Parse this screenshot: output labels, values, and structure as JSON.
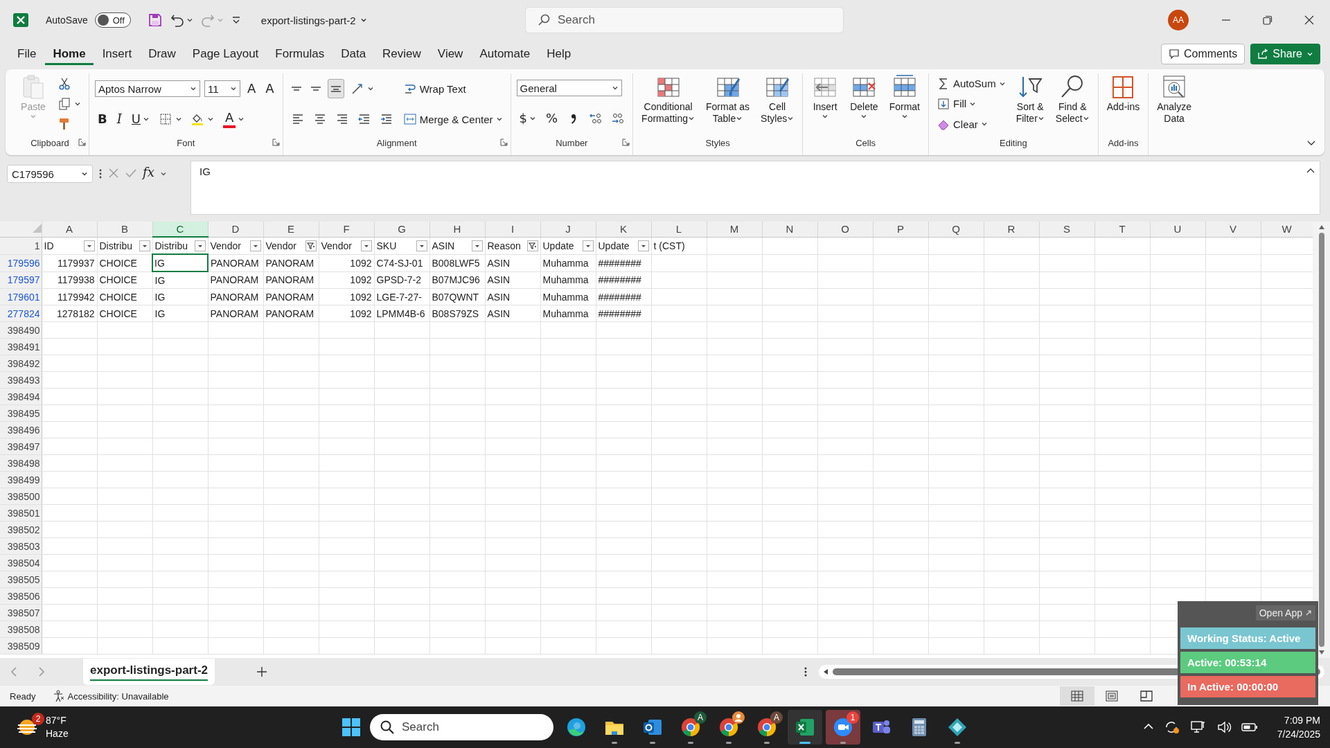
{
  "title_bar": {
    "autosave_label": "AutoSave",
    "autosave": {
      "on": false,
      "label": "Off"
    },
    "undo": {
      "disabled": false
    },
    "redo": {
      "disabled": true
    },
    "file_name": "export-listings-part-2",
    "search": {
      "placeholder": "Search"
    },
    "avatar": "AA"
  },
  "menu_tabs": [
    {
      "label": "File",
      "selected": false
    },
    {
      "label": "Home",
      "selected": true
    },
    {
      "label": "Insert",
      "selected": false
    },
    {
      "label": "Draw",
      "selected": false
    },
    {
      "label": "Page Layout",
      "selected": false
    },
    {
      "label": "Formulas",
      "selected": false
    },
    {
      "label": "Data",
      "selected": false
    },
    {
      "label": "Review",
      "selected": false
    },
    {
      "label": "View",
      "selected": false
    },
    {
      "label": "Automate",
      "selected": false
    },
    {
      "label": "Help",
      "selected": false
    }
  ],
  "header_buttons": [
    {
      "label": "Comments",
      "kind": "outline"
    },
    {
      "label": "Share",
      "kind": "primary"
    }
  ],
  "ribbon": {
    "groups": [
      {
        "label": "Clipboard",
        "launcher": true,
        "sections": [
          {
            "kind": "large",
            "lines": [
              "Paste"
            ],
            "caret": true,
            "disabled": true
          },
          {
            "kind": "stack",
            "tiers": [
              [
                {
                  "kind": "small"
                }
              ],
              [
                {
                  "kind": "small",
                  "caret": true
                }
              ],
              [
                {
                  "kind": "small"
                }
              ]
            ]
          }
        ]
      },
      {
        "label": "Font",
        "launcher": true,
        "sections": [
          {
            "kind": "stack",
            "tiers": [
              [
                {
                  "kind": "combo",
                  "text": "Aptos Narrow",
                  "wide": true
                },
                {
                  "kind": "combo",
                  "text": "11"
                },
                {
                  "kind": "glyph",
                  "text": "A"
                },
                {
                  "kind": "glyph",
                  "text": "A"
                }
              ],
              [
                {
                  "kind": "bold",
                  "text": "B"
                },
                {
                  "kind": "italic",
                  "text": "I"
                },
                {
                  "kind": "underline",
                  "text": "U",
                  "caret": true
                },
                {
                  "kind": "small",
                  "caret": true
                },
                {
                  "kind": "small",
                  "caret": true
                },
                {
                  "kind": "glyph",
                  "text": "A",
                  "color": "#e81123",
                  "caret": true
                }
              ]
            ]
          }
        ]
      },
      {
        "label": "Alignment",
        "launcher": true,
        "sections": [
          {
            "kind": "stack",
            "tiers": [
              [
                {
                  "kind": "small",
                  "pressed": false
                },
                {
                  "kind": "small",
                  "pressed": false
                },
                {
                  "kind": "small",
                  "pressed": true
                },
                {
                  "kind": "small",
                  "caret": true,
                  "pressed": false
                }
              ],
              [
                {
                  "kind": "small",
                  "pressed": false
                },
                {
                  "kind": "small",
                  "pressed": false
                },
                {
                  "kind": "small",
                  "pressed": false
                },
                {
                  "kind": "small",
                  "pressed": false
                },
                {
                  "kind": "small",
                  "pressed": false
                }
              ]
            ]
          },
          {
            "kind": "stack",
            "tiers": [
              [
                {
                  "kind": "small",
                  "text": "Wrap Text"
                }
              ],
              [
                {
                  "kind": "small",
                  "text": "Merge & Center",
                  "caret": true
                }
              ]
            ]
          }
        ]
      },
      {
        "label": "Number",
        "launcher": true,
        "sections": [
          {
            "kind": "stack",
            "tiers": [
              [
                {
                  "kind": "combo",
                  "text": "General",
                  "wide": true
                }
              ],
              [
                {
                  "kind": "glyph",
                  "text": "$",
                  "caret": true
                },
                {
                  "kind": "glyph",
                  "text": "%"
                },
                {
                  "kind": "small"
                },
                {
                  "kind": "small"
                },
                {
                  "kind": "small"
                }
              ]
            ]
          }
        ]
      },
      {
        "label": "Styles",
        "sections": [
          {
            "kind": "large",
            "lines": [
              "Conditional",
              "Formatting"
            ],
            "caret": true
          },
          {
            "kind": "large",
            "lines": [
              "Format as",
              "Table"
            ],
            "caret": true
          },
          {
            "kind": "large",
            "lines": [
              "Cell",
              "Styles"
            ],
            "caret": true
          }
        ]
      },
      {
        "label": "Cells",
        "sections": [
          {
            "kind": "large",
            "lines": [
              "Insert"
            ],
            "caret": true
          },
          {
            "kind": "large",
            "lines": [
              "Delete"
            ],
            "caret": true
          },
          {
            "kind": "large",
            "lines": [
              "Format"
            ],
            "caret": true
          }
        ]
      },
      {
        "label": "Editing",
        "sections": [
          {
            "kind": "stack",
            "tiers": [
              [
                {
                  "kind": "small",
                  "text": "AutoSum",
                  "caret": true
                }
              ],
              [
                {
                  "kind": "small",
                  "text": "Fill",
                  "caret": true
                }
              ],
              [
                {
                  "kind": "small",
                  "text": "Clear",
                  "caret": true
                }
              ]
            ]
          },
          {
            "kind": "large",
            "lines": [
              "Sort &",
              "Filter"
            ],
            "caret": true
          },
          {
            "kind": "large",
            "lines": [
              "Find &",
              "Select"
            ],
            "caret": true
          }
        ]
      },
      {
        "label": "Add-ins",
        "sections": [
          {
            "kind": "large",
            "lines": [
              "Add-ins"
            ]
          }
        ]
      },
      {
        "sections": [
          {
            "kind": "large",
            "lines": [
              "Analyze",
              "Data"
            ]
          }
        ]
      }
    ]
  },
  "formula_bar": {
    "name_box": "C179596",
    "function_label": "fx",
    "value": "IG"
  },
  "sheet": {
    "columns": [
      {
        "letter": "A",
        "selected": false
      },
      {
        "letter": "B",
        "selected": false
      },
      {
        "letter": "C",
        "selected": true
      },
      {
        "letter": "D",
        "selected": false
      },
      {
        "letter": "E",
        "selected": false
      },
      {
        "letter": "F",
        "selected": false
      },
      {
        "letter": "G",
        "selected": false
      },
      {
        "letter": "H",
        "selected": false
      },
      {
        "letter": "I",
        "selected": false
      },
      {
        "letter": "J",
        "selected": false
      },
      {
        "letter": "K",
        "selected": false
      },
      {
        "letter": "L",
        "selected": false
      },
      {
        "letter": "M",
        "selected": false
      },
      {
        "letter": "N",
        "selected": false
      },
      {
        "letter": "O",
        "selected": false
      },
      {
        "letter": "P",
        "selected": false
      },
      {
        "letter": "Q",
        "selected": false
      },
      {
        "letter": "R",
        "selected": false
      },
      {
        "letter": "S",
        "selected": false
      },
      {
        "letter": "T",
        "selected": false
      },
      {
        "letter": "U",
        "selected": false
      },
      {
        "letter": "V",
        "selected": false
      },
      {
        "letter": "W",
        "selected": false
      }
    ],
    "header_row": {
      "number": "1",
      "cells": [
        {
          "text": "ID",
          "kind": "filter",
          "filtered": false
        },
        {
          "text": "Distribu",
          "kind": "filter",
          "filtered": false
        },
        {
          "text": "Distribu",
          "kind": "filter",
          "filtered": false
        },
        {
          "text": "Vendor",
          "kind": "filter",
          "filtered": false
        },
        {
          "text": "Vendor",
          "kind": "filter",
          "filtered": true
        },
        {
          "text": "Vendor",
          "kind": "filter",
          "filtered": false
        },
        {
          "text": "SKU",
          "kind": "filter",
          "filtered": false
        },
        {
          "text": "ASIN",
          "kind": "filter",
          "filtered": false
        },
        {
          "text": "Reason",
          "kind": "filter",
          "filtered": true
        },
        {
          "text": "Update",
          "kind": "filter",
          "filtered": false
        },
        {
          "text": "Update",
          "kind": "filter",
          "filtered": false
        },
        {
          "text": "t (CST)",
          "kind": "plain"
        }
      ]
    },
    "rows": [
      {
        "number": "179596",
        "filtered": true,
        "cells": [
          {
            "text": "1179937",
            "kind": "number",
            "selected": false
          },
          {
            "text": "CHOICE",
            "kind": "text",
            "selected": false
          },
          {
            "text": "IG",
            "kind": "text",
            "selected": true
          },
          {
            "text": "PANORAM",
            "kind": "text",
            "selected": false
          },
          {
            "text": "PANORAM",
            "kind": "text",
            "selected": false
          },
          {
            "text": "1092",
            "kind": "number",
            "selected": false
          },
          {
            "text": "C74-SJ-01",
            "kind": "text",
            "selected": false
          },
          {
            "text": "B008LWF5",
            "kind": "text",
            "selected": false
          },
          {
            "text": "ASIN",
            "kind": "text",
            "selected": false
          },
          {
            "text": "Muhamma",
            "kind": "text",
            "selected": false
          },
          {
            "text": "########",
            "kind": "text",
            "selected": false
          }
        ]
      },
      {
        "number": "179597",
        "filtered": true,
        "cells": [
          {
            "text": "1179938",
            "kind": "number",
            "selected": false
          },
          {
            "text": "CHOICE",
            "kind": "text",
            "selected": false
          },
          {
            "text": "IG",
            "kind": "text",
            "selected": false
          },
          {
            "text": "PANORAM",
            "kind": "text",
            "selected": false
          },
          {
            "text": "PANORAM",
            "kind": "text",
            "selected": false
          },
          {
            "text": "1092",
            "kind": "number",
            "selected": false
          },
          {
            "text": "GPSD-7-2",
            "kind": "text",
            "selected": false
          },
          {
            "text": "B07MJC96",
            "kind": "text",
            "selected": false
          },
          {
            "text": "ASIN",
            "kind": "text",
            "selected": false
          },
          {
            "text": "Muhamma",
            "kind": "text",
            "selected": false
          },
          {
            "text": "########",
            "kind": "text",
            "selected": false
          }
        ]
      },
      {
        "number": "179601",
        "filtered": true,
        "cells": [
          {
            "text": "1179942",
            "kind": "number",
            "selected": false
          },
          {
            "text": "CHOICE",
            "kind": "text",
            "selected": false
          },
          {
            "text": "IG",
            "kind": "text",
            "selected": false
          },
          {
            "text": "PANORAM",
            "kind": "text",
            "selected": false
          },
          {
            "text": "PANORAM",
            "kind": "text",
            "selected": false
          },
          {
            "text": "1092",
            "kind": "number",
            "selected": false
          },
          {
            "text": "LGE-7-27-",
            "kind": "text",
            "selected": false
          },
          {
            "text": "B07QWNT",
            "kind": "text",
            "selected": false
          },
          {
            "text": "ASIN",
            "kind": "text",
            "selected": false
          },
          {
            "text": "Muhamma",
            "kind": "text",
            "selected": false
          },
          {
            "text": "########",
            "kind": "text",
            "selected": false
          }
        ]
      },
      {
        "number": "277824",
        "filtered": true,
        "cells": [
          {
            "text": "1278182",
            "kind": "number",
            "selected": false
          },
          {
            "text": "CHOICE",
            "kind": "text",
            "selected": false
          },
          {
            "text": "IG",
            "kind": "text",
            "selected": false
          },
          {
            "text": "PANORAM",
            "kind": "text",
            "selected": false
          },
          {
            "text": "PANORAM",
            "kind": "text",
            "selected": false
          },
          {
            "text": "1092",
            "kind": "number",
            "selected": false
          },
          {
            "text": "LPMM4B-6",
            "kind": "text",
            "selected": false
          },
          {
            "text": "B08S79ZS",
            "kind": "text",
            "selected": false
          },
          {
            "text": "ASIN",
            "kind": "text",
            "selected": false
          },
          {
            "text": "Muhamma",
            "kind": "text",
            "selected": false
          },
          {
            "text": "########",
            "kind": "text",
            "selected": false
          }
        ]
      },
      {
        "number": "398490",
        "filtered": false
      },
      {
        "number": "398491",
        "filtered": false
      },
      {
        "number": "398492",
        "filtered": false
      },
      {
        "number": "398493",
        "filtered": false
      },
      {
        "number": "398494",
        "filtered": false
      },
      {
        "number": "398495",
        "filtered": false
      },
      {
        "number": "398496",
        "filtered": false
      },
      {
        "number": "398497",
        "filtered": false
      },
      {
        "number": "398498",
        "filtered": false
      },
      {
        "number": "398499",
        "filtered": false
      },
      {
        "number": "398500",
        "filtered": false
      },
      {
        "number": "398501",
        "filtered": false
      },
      {
        "number": "398502",
        "filtered": false
      },
      {
        "number": "398503",
        "filtered": false
      },
      {
        "number": "398504",
        "filtered": false
      },
      {
        "number": "398505",
        "filtered": false
      },
      {
        "number": "398506",
        "filtered": false
      },
      {
        "number": "398507",
        "filtered": false
      },
      {
        "number": "398508",
        "filtered": false
      },
      {
        "number": "398509",
        "filtered": false
      }
    ]
  },
  "sheet_tabs": [
    {
      "label": "export-listings-part-2",
      "selected": true
    }
  ],
  "status_bar": {
    "status": "Ready",
    "accessibility": "Accessibility: Unavailable",
    "views": [
      {
        "kind": "normal",
        "selected": true
      },
      {
        "kind": "page_layout",
        "selected": false
      },
      {
        "kind": "page_break",
        "selected": false
      }
    ]
  },
  "tracker": {
    "open_app": "Open App",
    "bars": [
      {
        "text": "Working Status: Active",
        "color": "#79c6d1"
      },
      {
        "text": "Active: 00:53:14",
        "color": "#5ccb7f"
      },
      {
        "text": "In Active: 00:00:00",
        "color": "#e96a5f"
      }
    ]
  },
  "taskbar": {
    "weather": {
      "badge": "2",
      "temperature": "87°F",
      "condition": "Haze"
    },
    "search": {
      "placeholder": "Search"
    },
    "apps": [
      {
        "kind": "edge",
        "running": false,
        "active": false,
        "attention": false
      },
      {
        "kind": "explorer",
        "running": true,
        "active": false,
        "attention": false
      },
      {
        "kind": "outlook",
        "running": true,
        "active": false,
        "attention": false
      },
      {
        "kind": "chrome",
        "running": true,
        "active": false,
        "attention": false,
        "badge": {
          "kind": "letter",
          "text": "A",
          "color": "#1f5a3a"
        }
      },
      {
        "kind": "chrome",
        "running": true,
        "active": false,
        "attention": false,
        "badge": {
          "kind": "avatar",
          "color": "#e8883a"
        }
      },
      {
        "kind": "chrome",
        "running": true,
        "active": false,
        "attention": false,
        "badge": {
          "kind": "letter",
          "text": "A",
          "color": "#6b4a3a"
        }
      },
      {
        "kind": "excel",
        "running": true,
        "active": true,
        "attention": false
      },
      {
        "kind": "zoom",
        "running": true,
        "active": false,
        "attention": true,
        "badge": {
          "kind": "count",
          "text": "1",
          "color": "#e8453c"
        }
      },
      {
        "kind": "teams",
        "running": false,
        "active": false,
        "attention": false
      },
      {
        "kind": "calculator",
        "running": false,
        "active": false,
        "attention": false
      },
      {
        "kind": "app",
        "running": true,
        "active": false,
        "attention": false
      }
    ],
    "clock": {
      "time": "7:09 PM",
      "date": "7/24/2025"
    }
  }
}
